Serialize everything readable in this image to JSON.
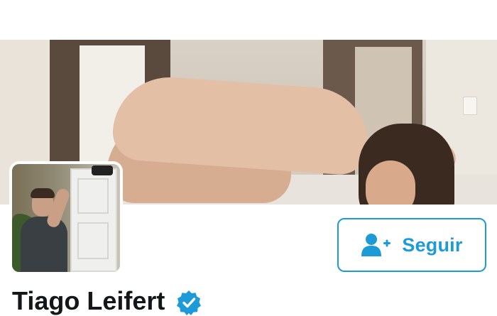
{
  "profile": {
    "display_name": "Tiago Leifert",
    "verified": true,
    "follow_button": {
      "label": "Seguir",
      "icon": "add-user-icon"
    }
  },
  "icons": {
    "verified": "verified-badge-icon",
    "follow": "add-user-icon"
  },
  "colors": {
    "accent": "#1d9bd8",
    "name_text": "#14171a",
    "background": "#ffffff"
  }
}
